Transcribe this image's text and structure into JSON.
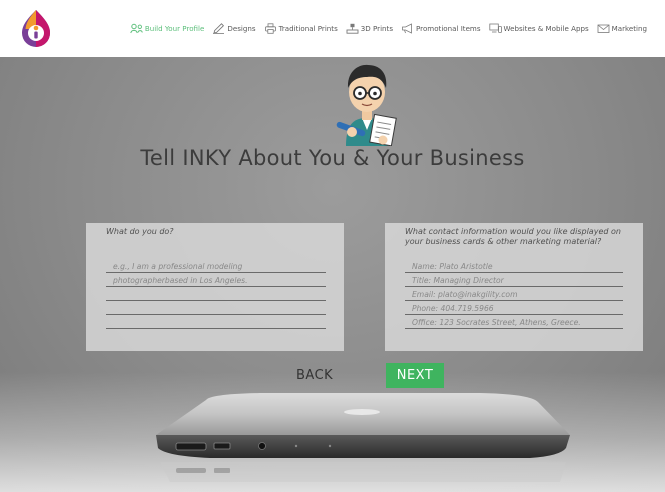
{
  "nav": {
    "items": [
      {
        "label": "Build Your Profile",
        "icon": "profile-icon",
        "active": true
      },
      {
        "label": "Designs",
        "icon": "pencil-icon",
        "active": false
      },
      {
        "label": "Traditional Prints",
        "icon": "printer-icon",
        "active": false
      },
      {
        "label": "3D Prints",
        "icon": "cube-printer-icon",
        "active": false
      },
      {
        "label": "Promotional Items",
        "icon": "megaphone-icon",
        "active": false
      },
      {
        "label": "Websites & Mobile Apps",
        "icon": "devices-icon",
        "active": false
      },
      {
        "label": "Marketing",
        "icon": "mail-icon",
        "active": false
      }
    ]
  },
  "colors": {
    "accent": "#3fb45f",
    "nav_active": "#5cbf7b",
    "logo_orange": "#f29a2e",
    "logo_purple": "#7a3f98",
    "logo_magenta": "#c4166c"
  },
  "hero": {
    "headline": "Tell INKY About You & Your Business"
  },
  "form": {
    "left": {
      "question": "What do you do?",
      "lines": [
        "e.g., I am a professional modeling",
        "photographerbased in Los Angeles.",
        "",
        "",
        ""
      ]
    },
    "right": {
      "question": "What contact information would you like displayed on your business cards & other marketing material?",
      "lines": [
        "Name: Plato Aristotle",
        "Title: Managing Director",
        "Email: plato@inakgility.com",
        "Phone: 404.719.5966",
        "Office: 123 Socrates Street, Athens, Greece."
      ]
    }
  },
  "buttons": {
    "back": "BACK",
    "next": "NEXT"
  }
}
